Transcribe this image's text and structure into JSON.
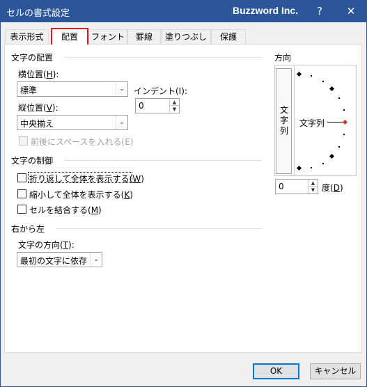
{
  "window": {
    "title": "セルの書式設定",
    "brand": "Buzzword Inc.",
    "help": "?",
    "close": "✕"
  },
  "tabs": [
    {
      "label": "表示形式"
    },
    {
      "label": "配置"
    },
    {
      "label": "フォント"
    },
    {
      "label": "罫線"
    },
    {
      "label": "塗りつぶし"
    },
    {
      "label": "保護"
    }
  ],
  "alignment": {
    "section_title": "文字の配置",
    "horizontal": {
      "label": "横位置(",
      "key": "H",
      "suffix": "):",
      "value": "標準"
    },
    "indent": {
      "label": "インデント(I):",
      "value": "0"
    },
    "vertical": {
      "label": "縦位置(",
      "key": "V",
      "suffix": "):",
      "value": "中央揃え"
    },
    "distributed": {
      "label": "前後にスペースを入れる(E)"
    }
  },
  "control": {
    "section_title": "文字の制御",
    "wrap": {
      "label": "折り返して全体を表示する(",
      "key": "W",
      "suffix": ")"
    },
    "shrink": {
      "label": "縮小して全体を表示する(",
      "key": "K",
      "suffix": ")"
    },
    "merge": {
      "label": "セルを結合する(",
      "key": "M",
      "suffix": ")"
    }
  },
  "rtl": {
    "section_title": "右から左",
    "direction": {
      "label": "文字の方向(",
      "key": "T",
      "suffix": "):",
      "value": "最初の文字に依存"
    }
  },
  "orientation": {
    "section_title": "方向",
    "vertical_text": [
      "文",
      "字",
      "列"
    ],
    "text_label": "文字列",
    "degrees": {
      "value": "0",
      "label": "度(",
      "key": "D",
      "suffix": ")"
    }
  },
  "footer": {
    "ok": "OK",
    "cancel": "キャンセル"
  },
  "colors": {
    "titlebar": "#2b579a",
    "active_tab_border": "#e81123",
    "focus": "#0078d7"
  }
}
